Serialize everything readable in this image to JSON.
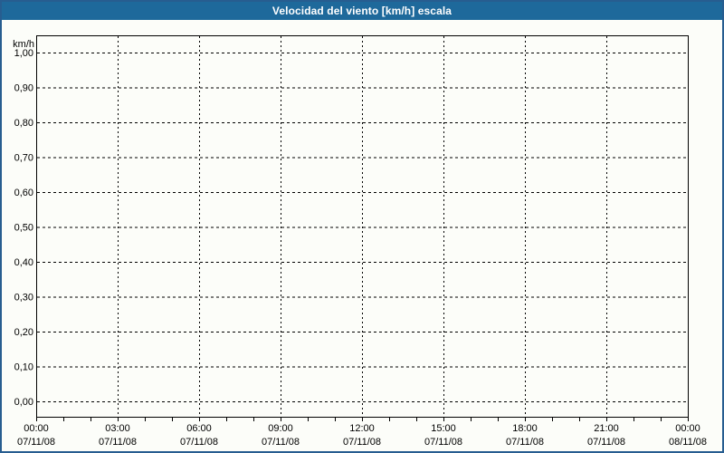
{
  "window": {
    "title": "Velocidad del viento [km/h] escala"
  },
  "colors": {
    "titlebar_bg": "#1e699b",
    "titlebar_text": "#ffffff",
    "window_border": "#275d90",
    "window_bg": "#fcfdf9",
    "plot_bg": "#fcfdf9",
    "grid_color": "#000000",
    "label_color": "#000000"
  },
  "chart_data": {
    "type": "line",
    "title": "Velocidad del viento [km/h] escala",
    "ylabel": "km/h",
    "xlabel": "",
    "ylim": [
      0.0,
      1.0
    ],
    "grid": true,
    "legend": false,
    "series": [],
    "y_ticks": [
      {
        "value": 0.0,
        "label": "0,00"
      },
      {
        "value": 0.1,
        "label": "0,10"
      },
      {
        "value": 0.2,
        "label": "0,20"
      },
      {
        "value": 0.3,
        "label": "0,30"
      },
      {
        "value": 0.4,
        "label": "0,40"
      },
      {
        "value": 0.5,
        "label": "0,50"
      },
      {
        "value": 0.6,
        "label": "0,60"
      },
      {
        "value": 0.7,
        "label": "0,70"
      },
      {
        "value": 0.8,
        "label": "0,80"
      },
      {
        "value": 0.9,
        "label": "0,90"
      },
      {
        "value": 1.0,
        "label": "1,00"
      }
    ],
    "x_axis": {
      "span_hours": 24,
      "major_step_hours": 3,
      "minor_step_hours": 1,
      "major_ticks": [
        {
          "time": "00:00",
          "date": "07/11/08"
        },
        {
          "time": "03:00",
          "date": "07/11/08"
        },
        {
          "time": "06:00",
          "date": "07/11/08"
        },
        {
          "time": "09:00",
          "date": "07/11/08"
        },
        {
          "time": "12:00",
          "date": "07/11/08"
        },
        {
          "time": "15:00",
          "date": "07/11/08"
        },
        {
          "time": "18:00",
          "date": "07/11/08"
        },
        {
          "time": "21:00",
          "date": "07/11/08"
        },
        {
          "time": "00:00",
          "date": "08/11/08"
        }
      ]
    }
  }
}
